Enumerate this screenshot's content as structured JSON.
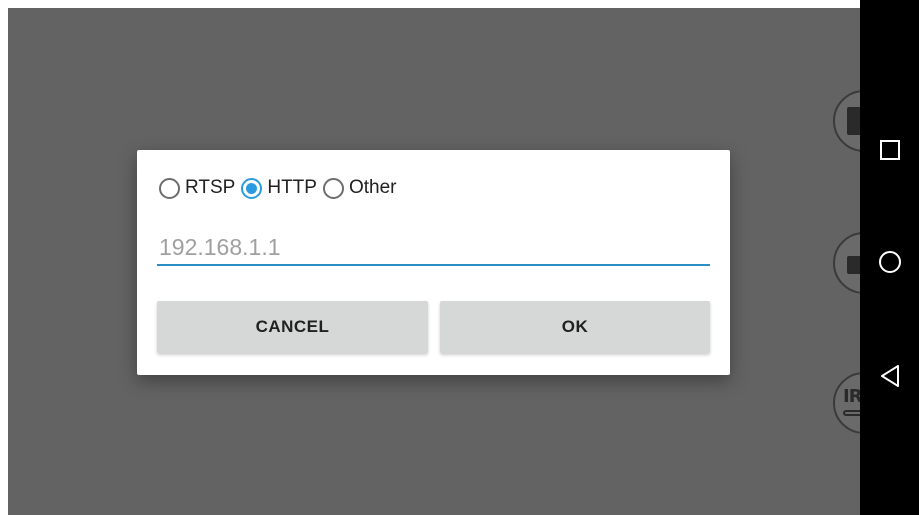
{
  "background": {
    "side_buttons": [
      {
        "icon": "save-icon"
      },
      {
        "icon": "camera-icon"
      },
      {
        "icon": "ir-icon",
        "label": "IR"
      }
    ]
  },
  "navbar": {
    "keys": [
      {
        "icon": "recent-apps-icon"
      },
      {
        "icon": "home-icon"
      },
      {
        "icon": "back-icon"
      }
    ]
  },
  "dialog": {
    "protocols": [
      {
        "label": "RTSP",
        "checked": false
      },
      {
        "label": "HTTP",
        "checked": true
      },
      {
        "label": "Other",
        "checked": false
      }
    ],
    "address": {
      "value": "",
      "placeholder": "192.168.1.1"
    },
    "cancel_label": "CANCEL",
    "ok_label": "OK"
  },
  "colors": {
    "accent": "#2b9be0",
    "underline": "#2b8fc7",
    "scrim": "#636363",
    "button": "#d6d7d7"
  }
}
